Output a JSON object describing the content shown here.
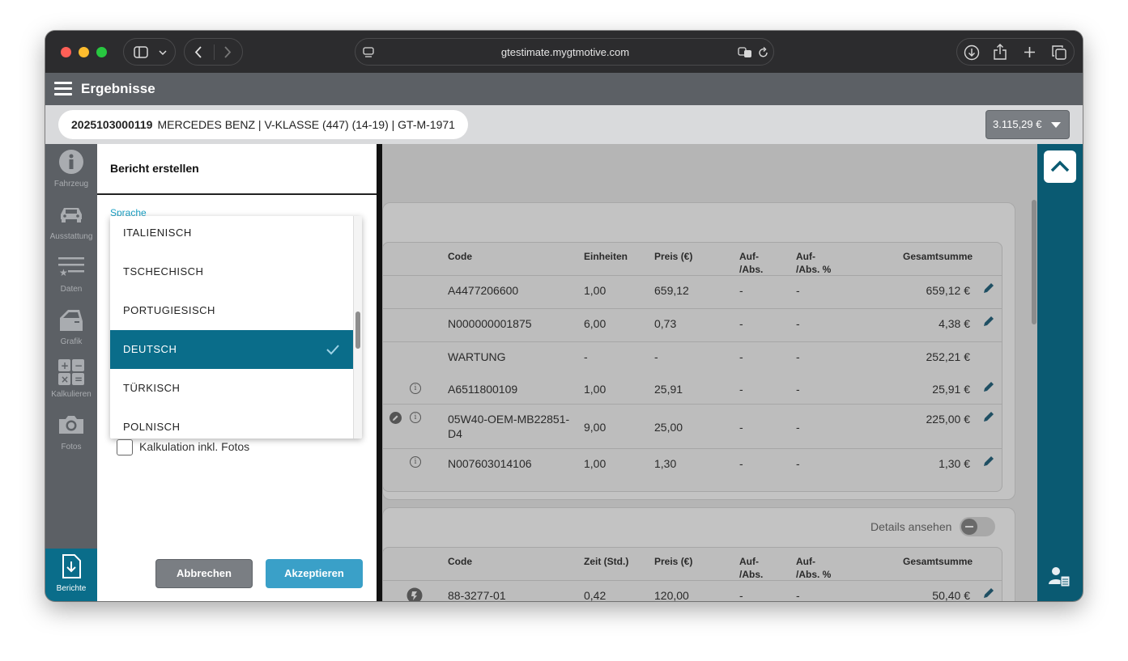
{
  "browser": {
    "url": "gtestimate.mygtmotive.com"
  },
  "app": {
    "title": "Ergebnisse",
    "vehicle": {
      "id": "2025103000119",
      "description": "MERCEDES BENZ | V-KLASSE (447) (14-19) | GT-M-1971"
    },
    "total_price": "3.115,29 €"
  },
  "rail": {
    "items": [
      {
        "label": "Fahrzeug",
        "icon": "info-icon"
      },
      {
        "label": "Ausstattung",
        "icon": "car-icon"
      },
      {
        "label": "Daten",
        "icon": "list-star-icon"
      },
      {
        "label": "Grafik",
        "icon": "car-door-icon"
      },
      {
        "label": "Kalkulieren",
        "icon": "calculator-icon"
      },
      {
        "label": "Fotos",
        "icon": "camera-icon"
      }
    ],
    "berichte": {
      "label": "Berichte",
      "icon": "download-document-icon"
    }
  },
  "dialog": {
    "title": "Bericht erstellen",
    "language_label": "Sprache",
    "options": [
      {
        "label": "ITALIENISCH",
        "selected": false
      },
      {
        "label": "TSCHECHISCH",
        "selected": false
      },
      {
        "label": "PORTUGIESISCH",
        "selected": false
      },
      {
        "label": "DEUTSCH",
        "selected": true
      },
      {
        "label": "TÜRKISCH",
        "selected": false
      },
      {
        "label": "POLNISCH",
        "selected": false
      }
    ],
    "checkbox_label": "Kalkulation inkl. Fotos",
    "cancel": "Abbrechen",
    "accept": "Akzeptieren"
  },
  "parts_table": {
    "headers": {
      "code": "Code",
      "units": "Einheiten",
      "price": "Preis (€)",
      "surcharge_a": "Auf-",
      "surcharge_b": "/Abs.",
      "surcharge_pct_a": "Auf-",
      "surcharge_pct_b": "/Abs. %",
      "total": "Gesamtsumme"
    },
    "rows": [
      {
        "code": "A4477206600",
        "units": "1,00",
        "price": "659,12",
        "s": "-",
        "sp": "-",
        "total": "659,12 €"
      },
      {
        "code": "N000000001875",
        "units": "6,00",
        "price": "0,73",
        "s": "-",
        "sp": "-",
        "total": "4,38 €"
      },
      {
        "code": "WARTUNG",
        "units": "-",
        "price": "-",
        "s": "-",
        "sp": "-",
        "total": "252,21 €"
      },
      {
        "code": "A6511800109",
        "units": "1,00",
        "price": "25,91",
        "s": "-",
        "sp": "-",
        "total": "25,91 €"
      },
      {
        "code": "05W40-OEM-MB22851-",
        "code2": "D4",
        "units": "9,00",
        "price": "25,00",
        "s": "-",
        "sp": "-",
        "total": "225,00 €"
      },
      {
        "code": "N007603014106",
        "units": "1,00",
        "price": "1,30",
        "s": "-",
        "sp": "-",
        "total": "1,30 €"
      }
    ]
  },
  "labor_table": {
    "details_label": "Details ansehen",
    "headers": {
      "code": "Code",
      "time": "Zeit (Std.)",
      "price": "Preis (€)",
      "surcharge_a": "Auf-",
      "surcharge_b": "/Abs.",
      "surcharge_pct_a": "Auf-",
      "surcharge_pct_b": "/Abs. %",
      "total": "Gesamtsumme"
    },
    "rows": [
      {
        "code": "88-3277-01",
        "time": "0,42",
        "price": "120,00",
        "s": "-",
        "sp": "-",
        "total": "50,40 €"
      }
    ]
  }
}
